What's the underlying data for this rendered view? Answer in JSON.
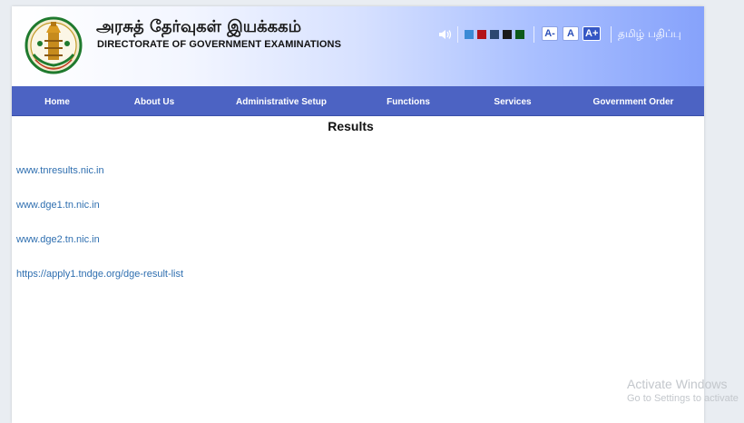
{
  "header": {
    "title_tamil": "அரசுத் தேர்வுகள் இயக்ககம்",
    "title_english": "DIRECTORATE OF GOVERNMENT EXAMINATIONS",
    "logo_icon": "tamil-nadu-emblem-icon",
    "speaker_icon": "speaker-icon",
    "theme_colors": [
      "#3b8ad6",
      "#b3121a",
      "#2d4770",
      "#1b1b1b",
      "#0d5a1a"
    ],
    "font_controls": [
      "A-",
      "A",
      "A+"
    ],
    "language_link": "தமிழ் பதிப்பு"
  },
  "nav": {
    "items": [
      "Home",
      "About Us",
      "Administrative Setup",
      "Functions",
      "Services",
      "Government Order"
    ]
  },
  "main": {
    "title": "Results",
    "links": [
      "www.tnresults.nic.in",
      "www.dge1.tn.nic.in",
      "www.dge2.tn.nic.in",
      "https://apply1.tndge.org/dge-result-list"
    ]
  },
  "watermark": {
    "line1": "Activate Windows",
    "line2": "Go to Settings to activate"
  },
  "colors": {
    "nav_bg": "#4c63c3",
    "link": "#2f6fb0",
    "header_gradient_end": "#86a2fb"
  }
}
